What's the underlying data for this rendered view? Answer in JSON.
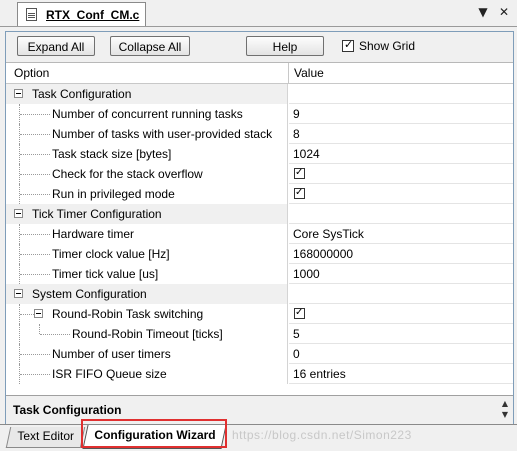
{
  "document_tab": {
    "label": "RTX_Conf_CM.c"
  },
  "window_controls": {
    "dropdown": "▼",
    "close": "✕"
  },
  "toolbar": {
    "expand_all": "Expand All",
    "collapse_all": "Collapse All",
    "help": "Help",
    "show_grid_label": "Show Grid",
    "show_grid_checked": true
  },
  "grid": {
    "columns": [
      "Option",
      "Value"
    ],
    "rows": [
      {
        "name": "Task Configuration",
        "value": "",
        "level": 0,
        "group": true
      },
      {
        "name": "Number of concurrent running tasks",
        "value": "9",
        "level": 1
      },
      {
        "name": "Number of tasks with user-provided stack",
        "value": "8",
        "level": 1
      },
      {
        "name": "Task stack size [bytes]",
        "value": "1024",
        "level": 1
      },
      {
        "name": "Check for the stack overflow",
        "value": "✓",
        "level": 1,
        "checkbox": true
      },
      {
        "name": "Run in privileged mode",
        "value": "✓",
        "level": 1,
        "checkbox": true
      },
      {
        "name": "Tick Timer Configuration",
        "value": "",
        "level": 0,
        "group": true
      },
      {
        "name": "Hardware timer",
        "value": "Core SysTick",
        "level": 1
      },
      {
        "name": "Timer clock value [Hz]",
        "value": "168000000",
        "level": 1
      },
      {
        "name": "Timer tick value [us]",
        "value": "1000",
        "level": 1
      },
      {
        "name": "System Configuration",
        "value": "",
        "level": 0,
        "group": true
      },
      {
        "name": "Round-Robin Task switching",
        "value": "✓",
        "level": 1,
        "checkbox": true,
        "expandable": true
      },
      {
        "name": "Round-Robin Timeout [ticks]",
        "value": "5",
        "level": 2
      },
      {
        "name": "Number of user timers",
        "value": "0",
        "level": 1
      },
      {
        "name": "ISR FIFO Queue size",
        "value": "16 entries",
        "level": 1
      }
    ]
  },
  "description": {
    "title": "Task Configuration"
  },
  "bottom_tabs": [
    {
      "label": "Text Editor",
      "active": false
    },
    {
      "label": "Configuration Wizard",
      "active": true
    }
  ],
  "watermark": "https://blog.csdn.net/Simon223",
  "colors": {
    "highlight": "#e03030",
    "panel_border": "#7f9db9"
  }
}
